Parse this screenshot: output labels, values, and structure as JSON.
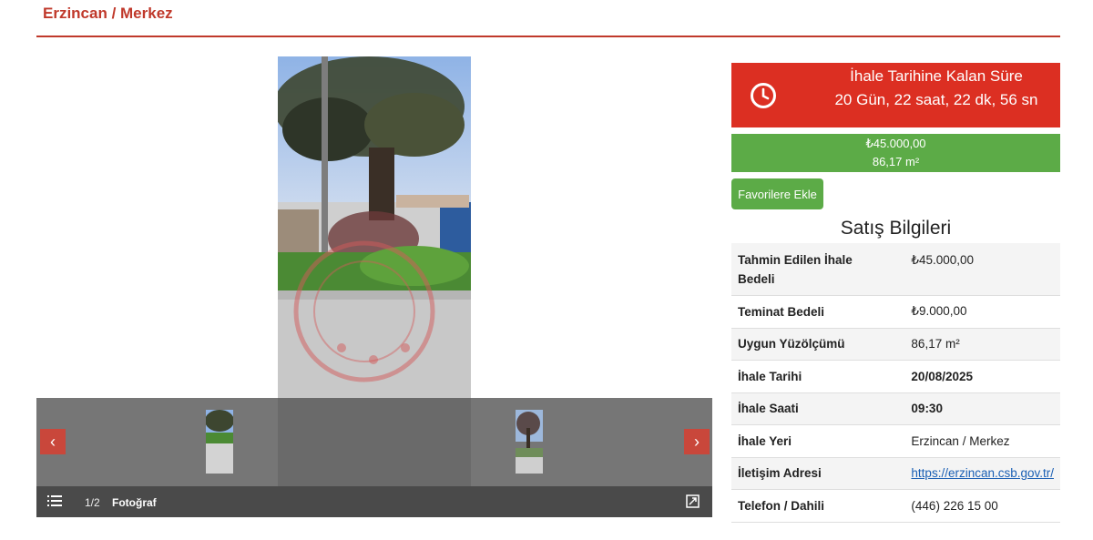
{
  "header": {
    "title": "Erzincan / Merkez"
  },
  "gallery": {
    "counter": "1/2",
    "label": "Fotoğraf",
    "prev_arrow": "‹",
    "next_arrow": "›"
  },
  "countdown": {
    "title": "İhale Tarihine Kalan Süre",
    "time": "20 Gün, 22 saat, 22 dk, 56 sn"
  },
  "price": {
    "amount": "₺45.000,00",
    "area": "86,17 m²"
  },
  "favorite_button": "Favorilere Ekle",
  "sale_info": {
    "title": "Satış Bilgileri",
    "rows": [
      {
        "key": "Tahmin Edilen İhale Bedeli",
        "value": "₺45.000,00"
      },
      {
        "key": "Teminat Bedeli",
        "value": "₺9.000,00"
      },
      {
        "key": "Uygun Yüzölçümü",
        "value": "86,17 m²"
      },
      {
        "key": "İhale Tarihi",
        "value": "20/08/2025"
      },
      {
        "key": "İhale Saati",
        "value": "09:30"
      },
      {
        "key": "İhale Yeri",
        "value": "Erzincan / Merkez"
      },
      {
        "key": "İletişim Adresi",
        "value": "https://erzincan.csb.gov.tr/"
      },
      {
        "key": "Telefon / Dahili",
        "value": "(446) 226 15 00"
      }
    ]
  },
  "colors": {
    "brand_red": "#c0392b",
    "countdown_red": "#dc2f22",
    "green": "#5cab47",
    "link_blue": "#1a5fb4"
  }
}
